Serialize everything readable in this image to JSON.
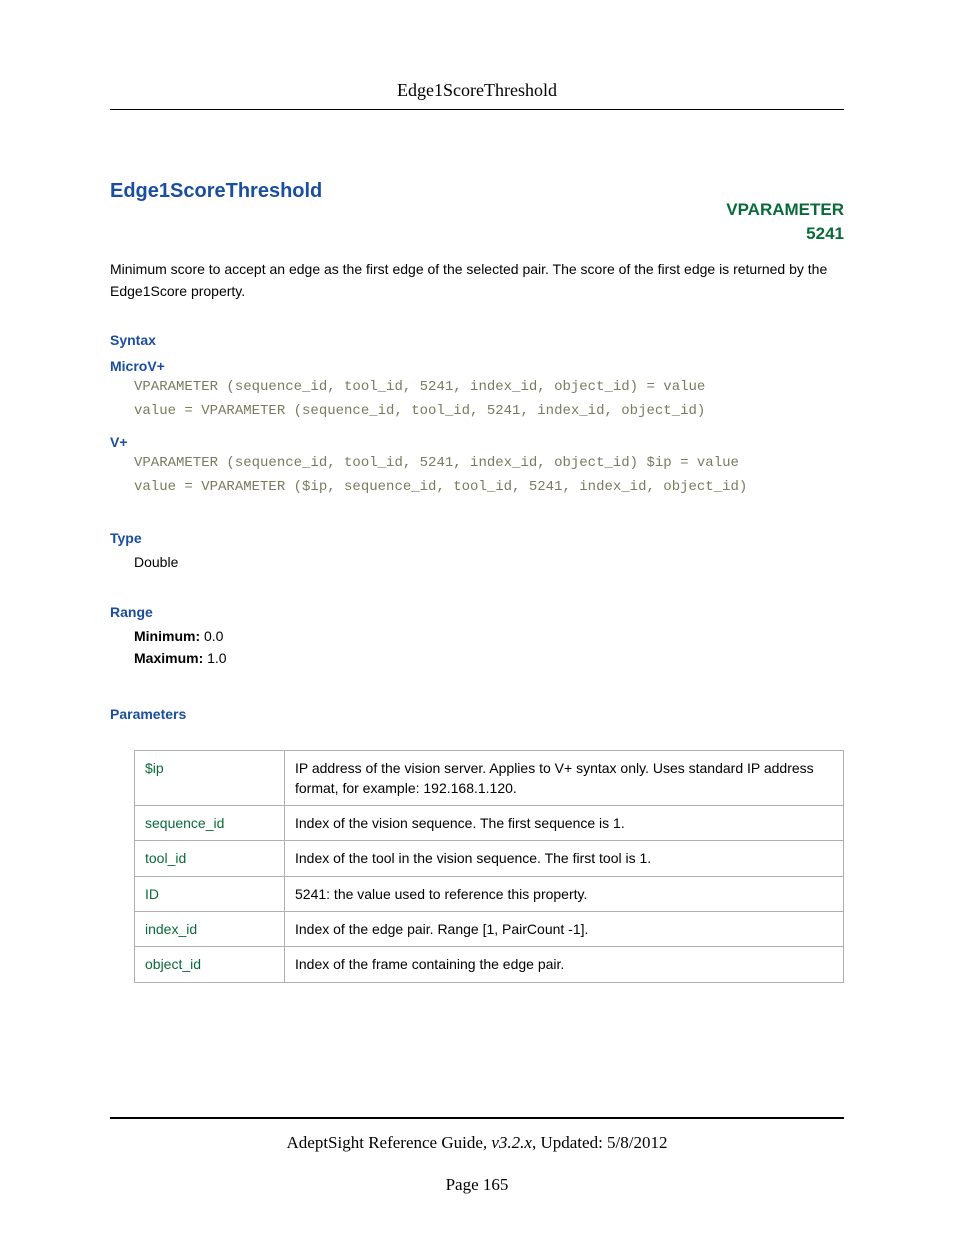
{
  "header": {
    "topic": "Edge1ScoreThreshold"
  },
  "title": "Edge1ScoreThreshold",
  "vparam": {
    "label": "VPARAMETER",
    "id": "5241"
  },
  "description": "Minimum score to accept an edge as the first edge of the selected pair. The score of the first edge is returned by the Edge1Score property.",
  "syntax": {
    "heading": "Syntax",
    "microv": {
      "label": "MicroV+",
      "code": "VPARAMETER (sequence_id, tool_id, 5241, index_id, object_id) = value\nvalue = VPARAMETER (sequence_id, tool_id, 5241, index_id, object_id)"
    },
    "vplus": {
      "label": "V+",
      "code": "VPARAMETER (sequence_id, tool_id, 5241, index_id, object_id) $ip = value\nvalue = VPARAMETER ($ip, sequence_id, tool_id, 5241, index_id, object_id)"
    }
  },
  "type": {
    "heading": "Type",
    "value": "Double"
  },
  "range": {
    "heading": "Range",
    "min_label": "Minimum:",
    "min_value": " 0.0",
    "max_label": "Maximum:",
    "max_value": " 1.0"
  },
  "parameters": {
    "heading": "Parameters",
    "rows": [
      {
        "name": "$ip",
        "desc": "IP address of the vision server. Applies to V+ syntax only. Uses standard IP address format, for example: 192.168.1.120."
      },
      {
        "name": "sequence_id",
        "desc": "Index of the vision sequence. The first sequence is 1."
      },
      {
        "name": "tool_id",
        "desc": "Index of the tool in the vision sequence. The first tool is 1."
      },
      {
        "name": "ID",
        "desc": "5241: the value used to reference this property."
      },
      {
        "name": "index_id",
        "desc": "Index of the edge pair. Range [1, PairCount -1]."
      },
      {
        "name": "object_id",
        "desc": "Index of the frame containing the edge pair."
      }
    ]
  },
  "footer": {
    "guide": "AdeptSight Reference Guide",
    "version": ", v3.2.x",
    "updated": ", Updated: 5/8/2012",
    "page": "Page 165"
  }
}
